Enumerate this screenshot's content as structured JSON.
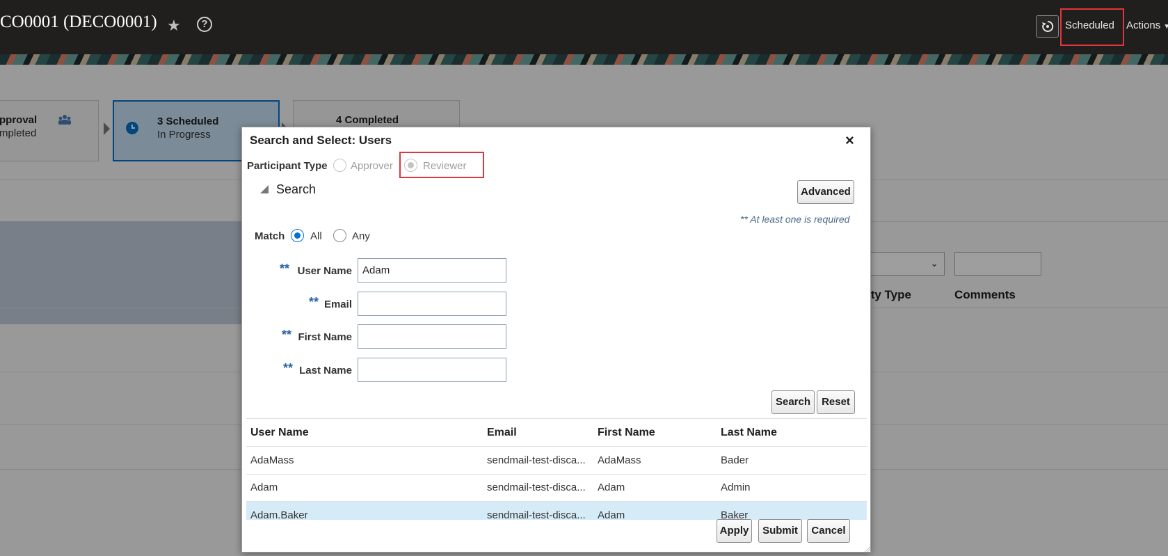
{
  "header": {
    "title": "CO0001 (DECO0001)",
    "scheduled_label": "Scheduled",
    "actions_label": "Actions"
  },
  "train": {
    "step2": {
      "title": "pproval",
      "status": "mpleted"
    },
    "step3": {
      "title": "3 Scheduled",
      "status": "In Progress"
    },
    "step4": {
      "title": "4 Completed"
    }
  },
  "background_table": {
    "columns": [
      "ity Type",
      "Comments"
    ]
  },
  "dialog": {
    "title": "Search and Select: Users",
    "participant_type_label": "Participant Type",
    "participant_options": [
      "Approver",
      "Reviewer"
    ],
    "search_section_label": "Search",
    "advanced_button": "Advanced",
    "required_note": "** At least one is required",
    "match_label": "Match",
    "match_options": [
      "All",
      "Any"
    ],
    "required_marker": "**",
    "fields": {
      "user_name": {
        "label": "User Name",
        "value": "Adam"
      },
      "email": {
        "label": "Email",
        "value": ""
      },
      "first_name": {
        "label": "First Name",
        "value": ""
      },
      "last_name": {
        "label": "Last Name",
        "value": ""
      }
    },
    "search_button": "Search",
    "reset_button": "Reset",
    "results": {
      "columns": [
        "User Name",
        "Email",
        "First Name",
        "Last Name"
      ],
      "rows": [
        [
          "AdaMass",
          "sendmail-test-disca...",
          "AdaMass",
          "Bader"
        ],
        [
          "Adam",
          "sendmail-test-disca...",
          "Adam",
          "Admin"
        ],
        [
          "Adam.Baker",
          "sendmail-test-disca...",
          "Adam",
          "Baker"
        ]
      ]
    },
    "apply_button": "Apply",
    "submit_button": "Submit",
    "cancel_button": "Cancel"
  },
  "colors": {
    "header_bg": "#201f1d",
    "accent": "#0572ce",
    "highlight_box": "#e0363b",
    "selected_row": "#d6ebf8"
  }
}
